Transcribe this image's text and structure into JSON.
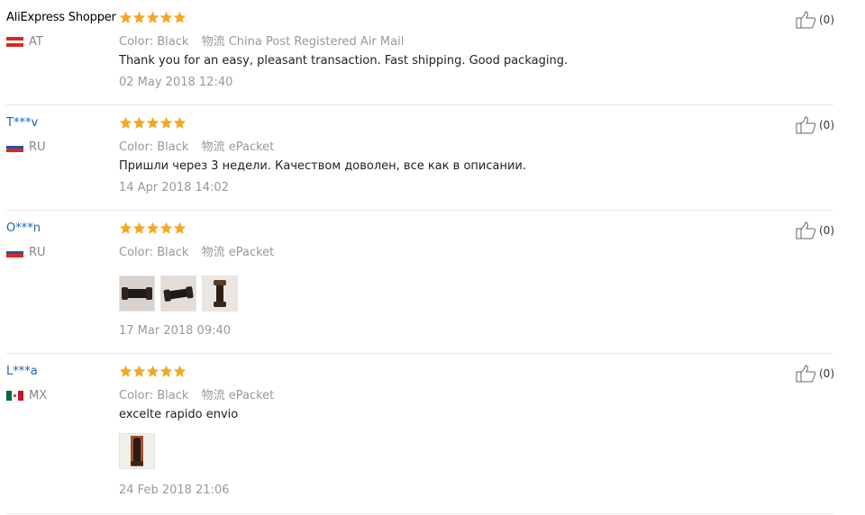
{
  "reviews": [
    {
      "user": "AliExpress Shopper",
      "country": "AT",
      "rating": 5,
      "color_label": "Color:",
      "color_value": "Black",
      "logistics_label": "物流",
      "logistics_value": "China Post Registered Air Mail",
      "feedback": "Thank you for an easy, pleasant transaction. Fast shipping. Good packaging.",
      "date": "02 May 2018 12:40",
      "useful_count": "(0)"
    },
    {
      "user": "T***v",
      "country": "RU",
      "rating": 5,
      "color_label": "Color:",
      "color_value": "Black",
      "logistics_label": "物流",
      "logistics_value": "ePacket",
      "feedback": "Пришли через 3 недели. Качеством доволен, все как в описании.",
      "date": "14 Apr 2018 14:02",
      "useful_count": "(0)"
    },
    {
      "user": "O***n",
      "country": "RU",
      "rating": 5,
      "color_label": "Color:",
      "color_value": "Black",
      "logistics_label": "物流",
      "logistics_value": "ePacket",
      "feedback": "",
      "date": "17 Mar 2018 09:40",
      "useful_count": "(0)",
      "photos": 3
    },
    {
      "user": "L***a",
      "country": "MX",
      "rating": 5,
      "color_label": "Color:",
      "color_value": "Black",
      "logistics_label": "物流",
      "logistics_value": "ePacket",
      "feedback": "excelte rapido envio",
      "date": "24 Feb 2018 21:06",
      "useful_count": "(0)",
      "photos": 1
    }
  ],
  "colors": {
    "star": "#f5a623",
    "masked_user": "#1a66b3",
    "muted": "#999999"
  }
}
